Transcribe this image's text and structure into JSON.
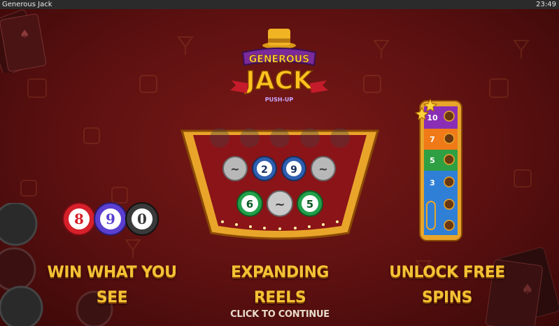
{
  "window": {
    "title": "Generous Jack",
    "clock": "23:49"
  },
  "logo": {
    "line1": "GENEROUS",
    "line2": "JACK",
    "sub": "PUSH-UP"
  },
  "features": [
    {
      "label": "WIN WHAT YOU SEE"
    },
    {
      "label": "EXPANDING REELS"
    },
    {
      "label": "UNLOCK FREE SPINS"
    }
  ],
  "chips_demo": {
    "values": [
      "8",
      "9",
      "0"
    ],
    "colors": [
      "#d6202a",
      "#5a3fd0",
      "#3a3a3a"
    ]
  },
  "reels_demo": {
    "top_row": [
      "",
      "",
      "",
      "",
      ""
    ],
    "mid_row": [
      "~",
      "2",
      "9",
      "~"
    ],
    "bottom_row": [
      "6",
      "~",
      "5"
    ]
  },
  "ladder_demo": {
    "steps": [
      "10",
      "7",
      "5",
      "3"
    ],
    "colors": [
      "#8a2fb5",
      "#f07a18",
      "#2ea043",
      "#2f7fd6"
    ]
  },
  "continue_label": "CLICK TO CONTINUE",
  "colors": {
    "background": "#5c1010",
    "caption": "#f4c235",
    "gold": "#e9a52a"
  }
}
